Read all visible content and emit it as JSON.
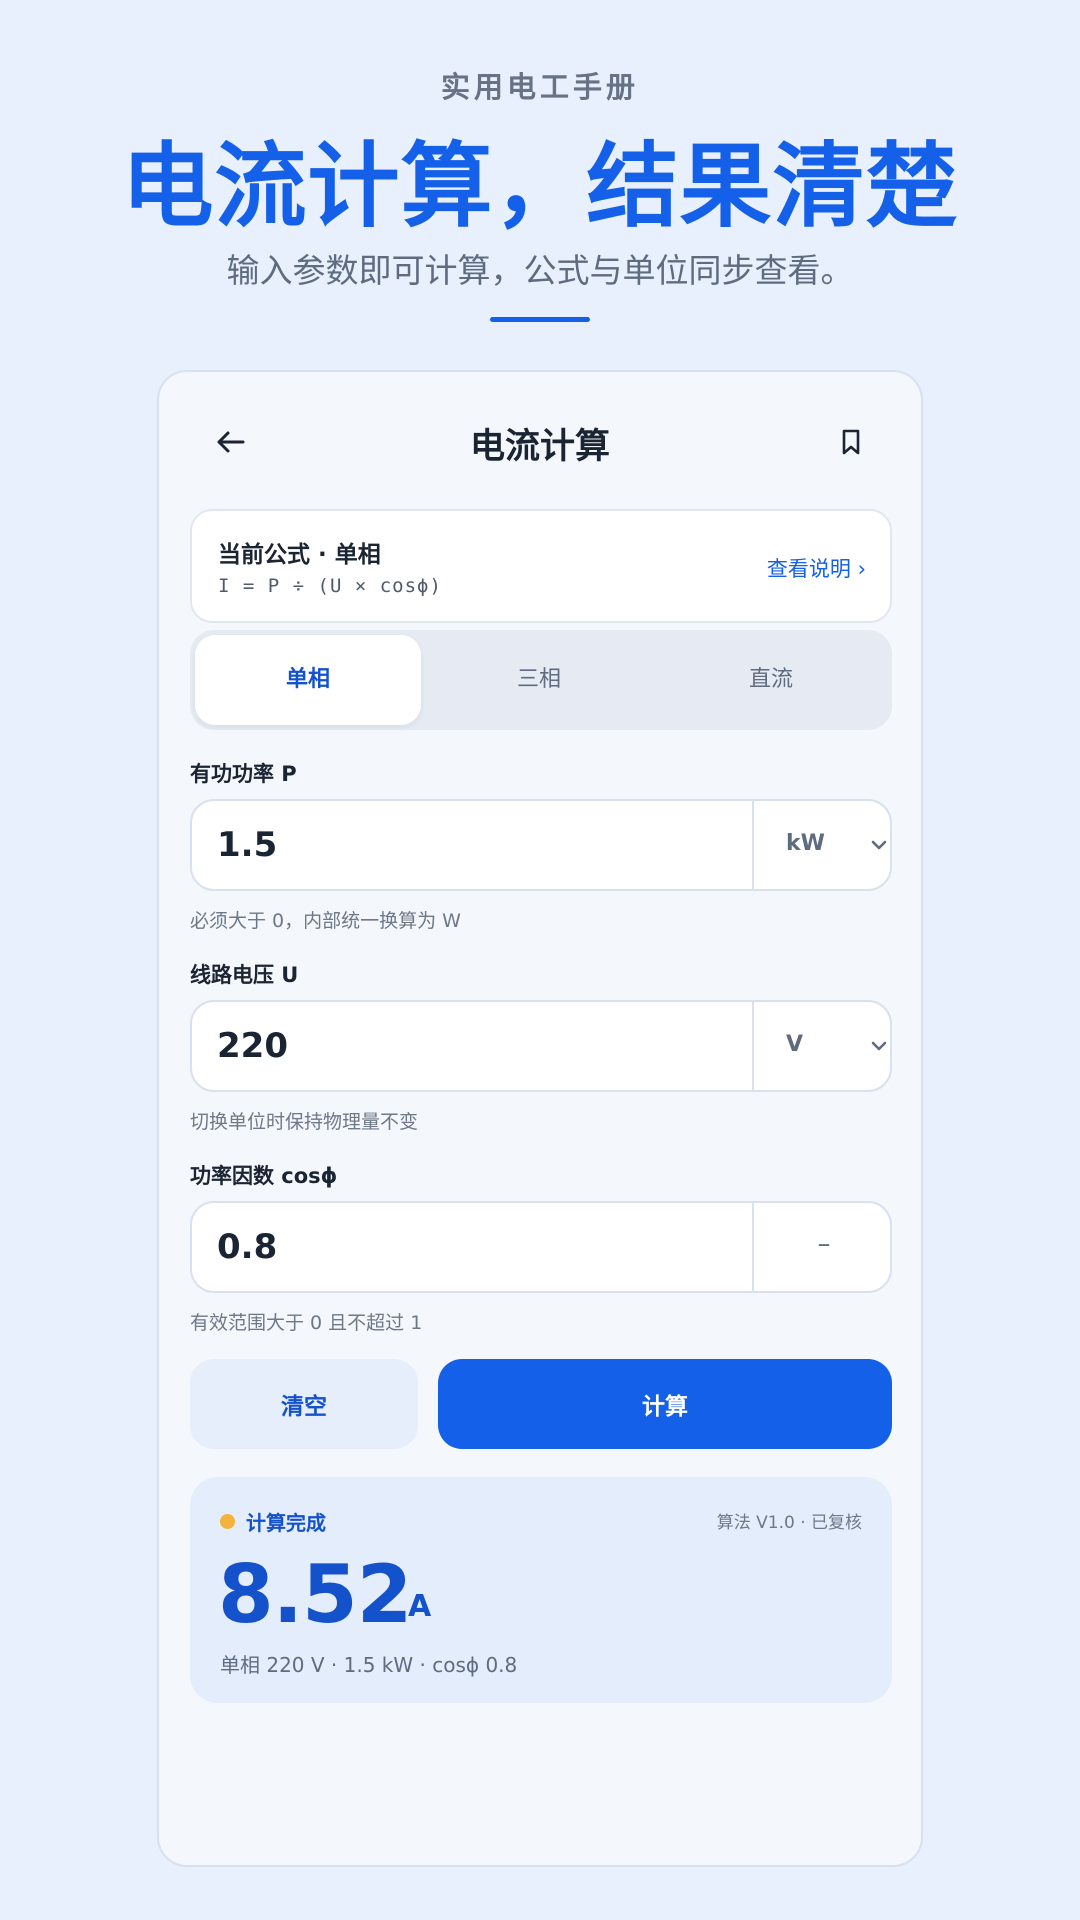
{
  "hero": {
    "eyebrow": "实用电工手册",
    "headline": "电流计算，结果清楚",
    "subline": "输入参数即可计算，公式与单位同步查看。"
  },
  "topbar": {
    "title": "电流计算",
    "back_icon": "arrow-left-icon",
    "bookmark_icon": "bookmark-icon"
  },
  "formula": {
    "title": "当前公式 · 单相",
    "expression": "I = P ÷ (U × cosϕ)",
    "link": "查看说明 ›"
  },
  "modes": {
    "items": [
      "单相",
      "三相",
      "直流"
    ],
    "selected": "单相"
  },
  "fields": [
    {
      "label": "有功功率 P",
      "value": "1.5",
      "unit": "kW",
      "hint": "必须大于 0，内部统一换算为 W"
    },
    {
      "label": "线路电压 U",
      "value": "220",
      "unit": "V",
      "hint": "切换单位时保持物理量不变"
    },
    {
      "label": "功率因数 cosϕ",
      "value": "0.8",
      "unit": "–",
      "hint": "有效范围大于 0 且不超过 1"
    }
  ],
  "actions": {
    "clear": "清空",
    "calculate": "计算"
  },
  "result": {
    "status": "计算完成",
    "algorithm": "算法 V1.0 · 已复核",
    "value": "8.52",
    "unit": "A",
    "summary": "单相 220 V · 1.5 kW · cosϕ 0.8"
  },
  "colors": {
    "background": "#e8f0fd",
    "accent": "#1560e8",
    "accent_dark": "#1452cc",
    "status_dot": "#f5b23c"
  }
}
